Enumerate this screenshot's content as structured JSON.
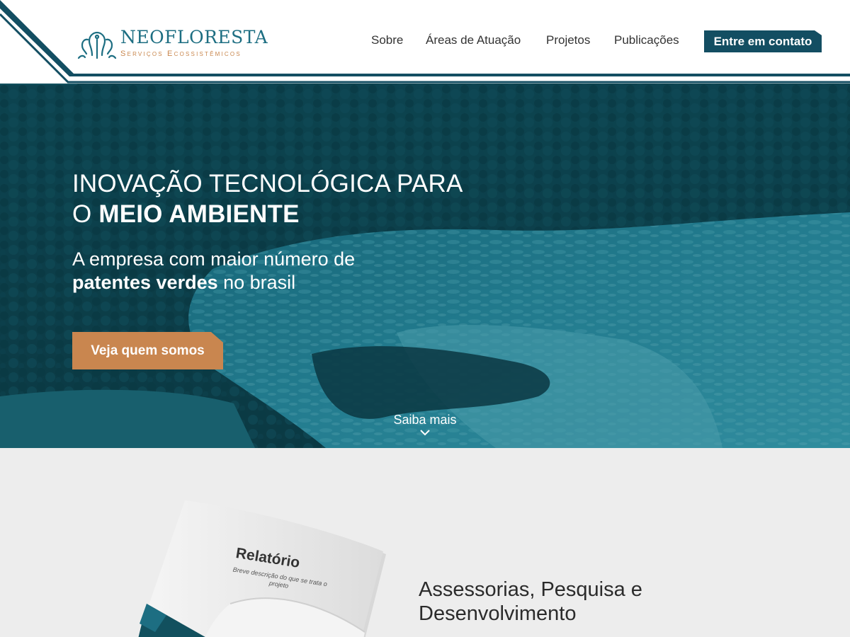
{
  "brand": {
    "name": "NEOFLORESTA",
    "tagline": "Serviços Ecossistêmicos",
    "primary_color": "#134e62",
    "accent_color": "#c9864f"
  },
  "nav": {
    "items": [
      {
        "label": "Sobre"
      },
      {
        "label": "Áreas de Atuação"
      },
      {
        "label": "Projetos"
      },
      {
        "label": "Publicações"
      }
    ],
    "contact_label": "Entre em contato"
  },
  "hero": {
    "title_line1": "INOVAÇÃO TECNOLÓGICA PARA",
    "title_line2_prefix": "O ",
    "title_line2_bold": "MEIO AMBIENTE",
    "subtitle_line1": "A empresa com maior número de",
    "subtitle_bold": "patentes verdes",
    "subtitle_rest": " no brasil",
    "cta_label": "Veja quem somos",
    "scroll_label": "Saiba mais",
    "scroll_icon": "chevron-down-icon"
  },
  "section": {
    "title_line1": "Assessorias, Pesquisa e",
    "title_line2": "Desenvolvimento",
    "report_title": "Relatório",
    "report_desc": "Breve descrição do que se trata o projeto"
  }
}
